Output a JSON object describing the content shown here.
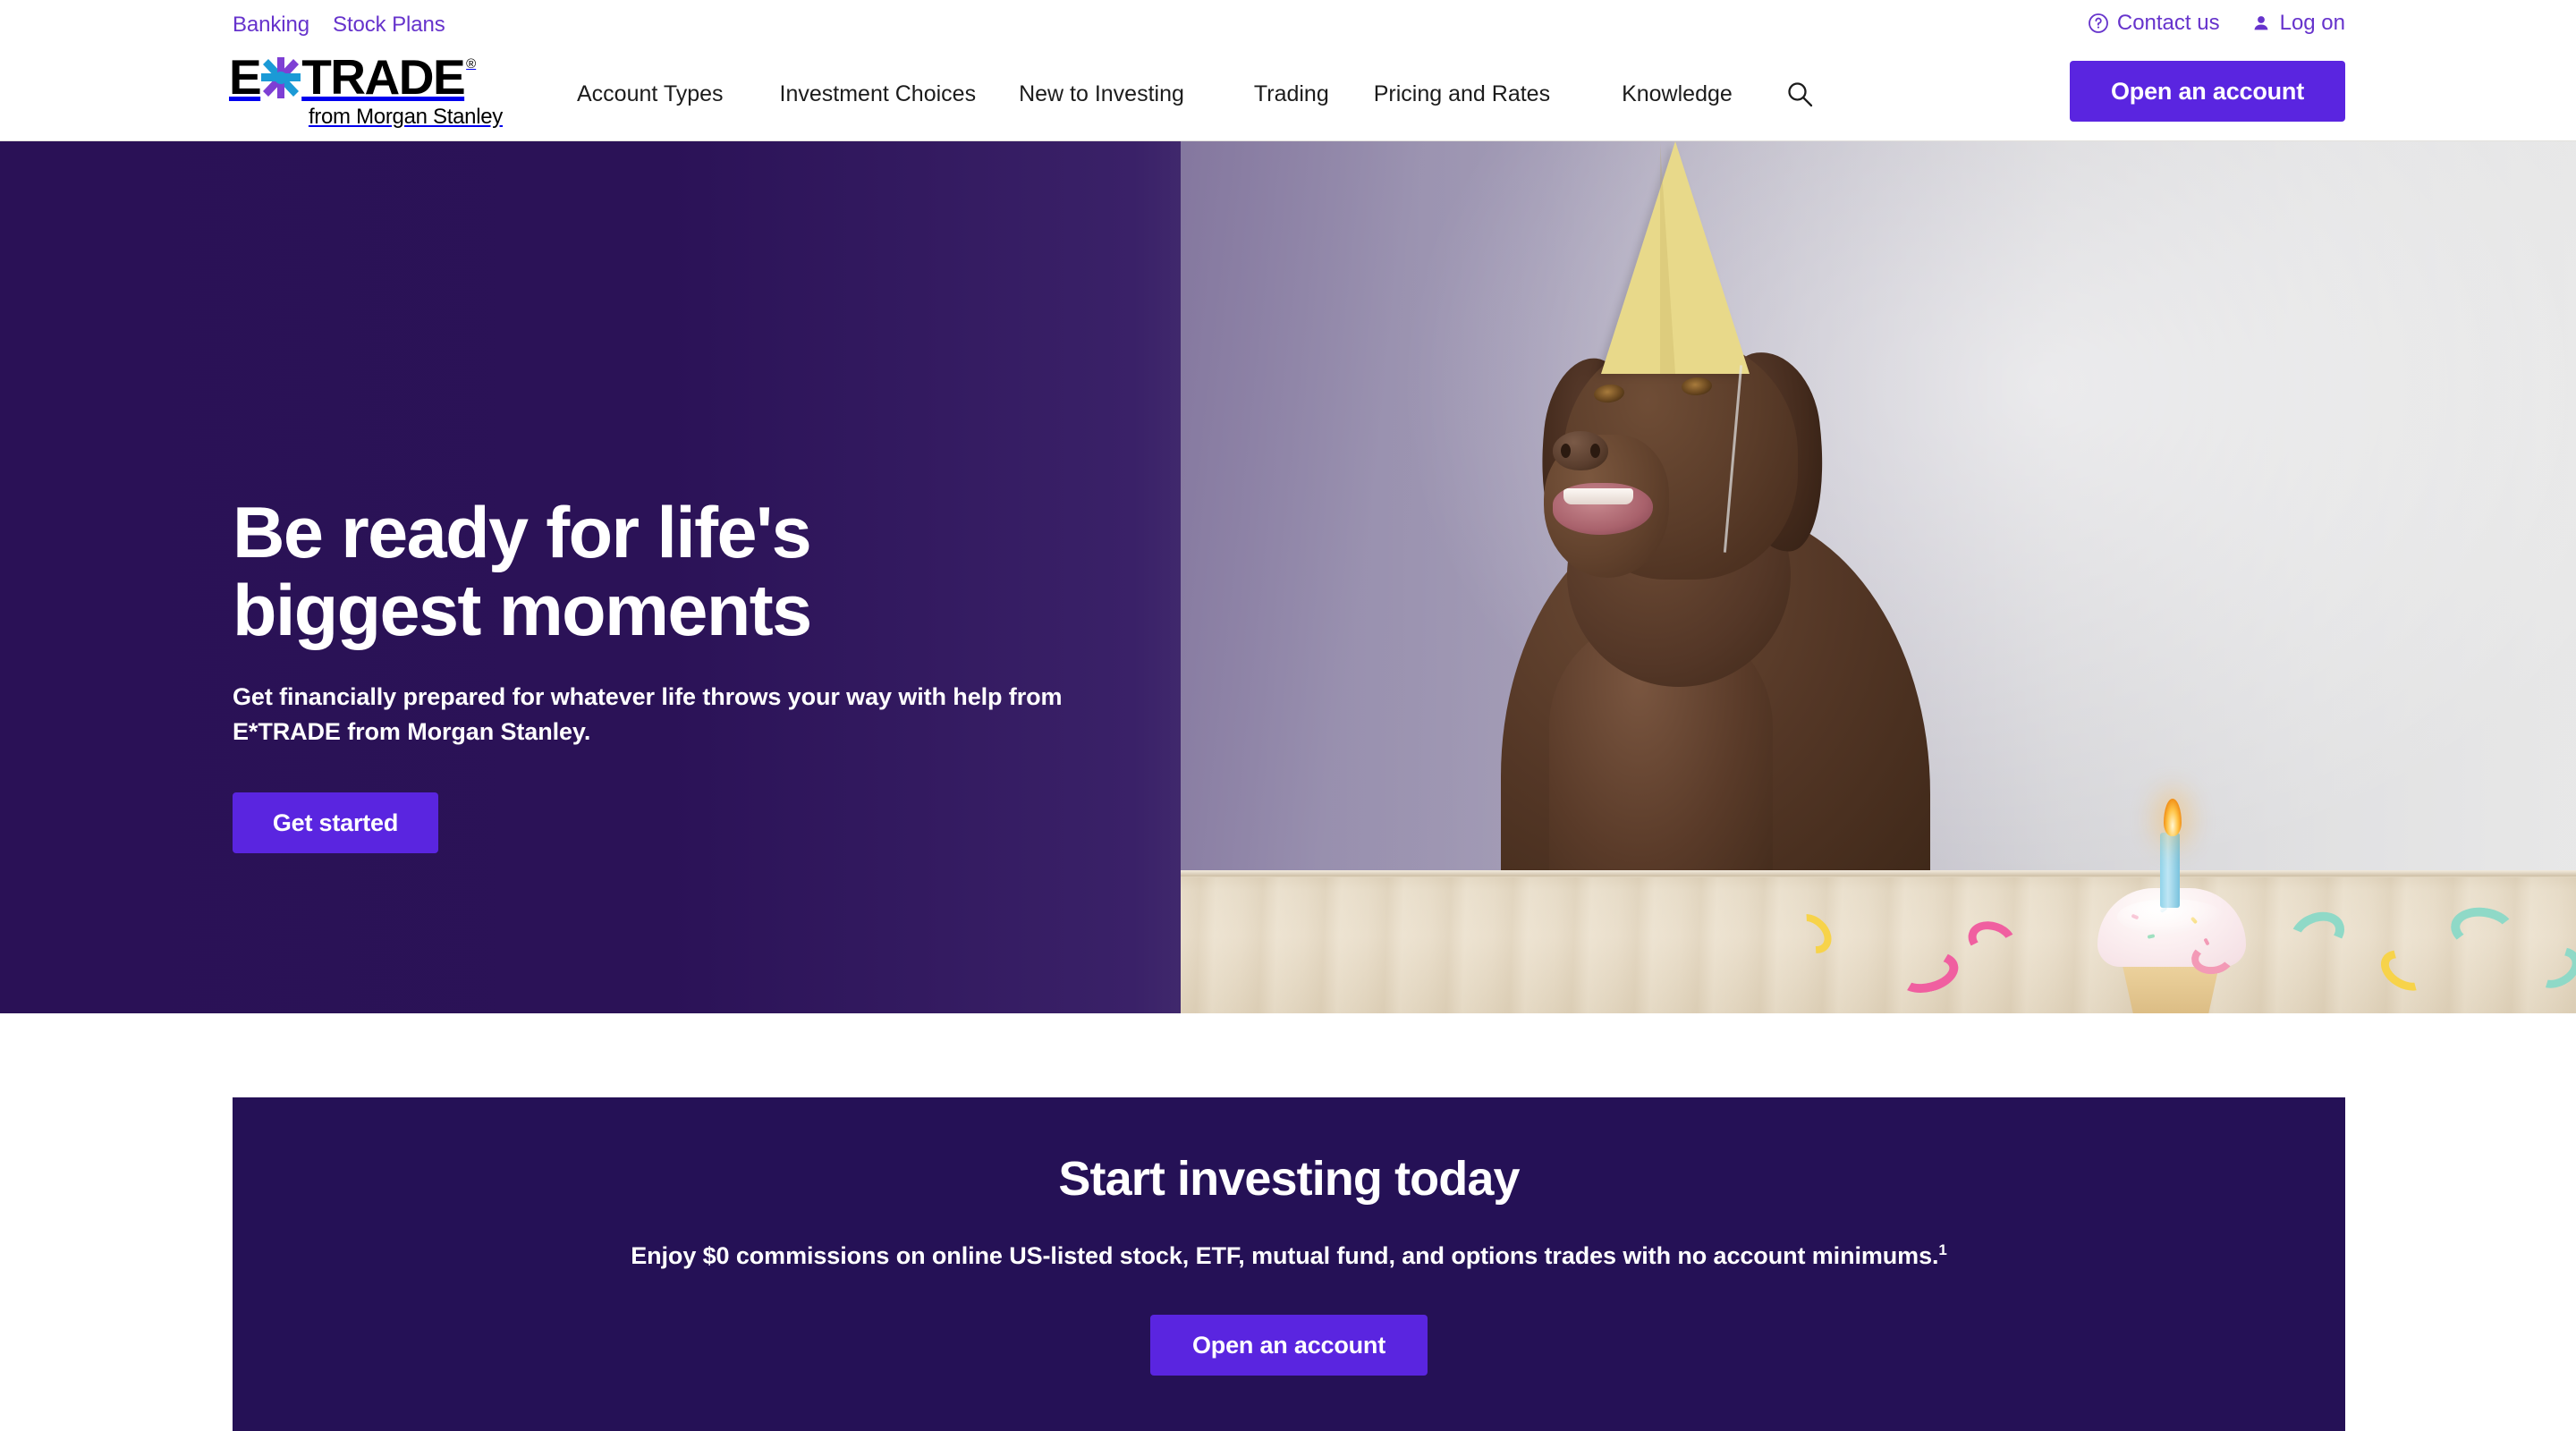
{
  "header": {
    "utility_left": [
      {
        "label": "Banking"
      },
      {
        "label": "Stock Plans"
      }
    ],
    "utility_right": [
      {
        "label": "Contact us",
        "icon": "question-circle-icon"
      },
      {
        "label": "Log on",
        "icon": "person-icon"
      }
    ],
    "logo": {
      "part1": "E",
      "star": "asterisk-star-icon",
      "part2": "TRADE",
      "registered": "®",
      "tagline": "from Morgan Stanley"
    },
    "nav": [
      {
        "label": "Account Types"
      },
      {
        "label": "Investment Choices"
      },
      {
        "label": "New to Investing"
      },
      {
        "label": "Trading"
      },
      {
        "label": "Pricing and Rates"
      },
      {
        "label": "Knowledge"
      }
    ],
    "search_icon": "search-icon",
    "open_account_label": "Open an account"
  },
  "hero": {
    "title_line1": "Be ready for life's",
    "title_line2": "biggest moments",
    "subtitle": "Get financially prepared for whatever life throws your way with help from E*TRADE from Morgan Stanley.",
    "cta_label": "Get started",
    "image_alt": "chocolate-labrador-with-party-hat-and-cupcake"
  },
  "cta_card": {
    "title": "Start investing today",
    "subtitle": "Enjoy $0 commissions on online US-listed stock, ETF, mutual fund, and options trades with no account minimums.",
    "footnote_marker": "1",
    "button_label": "Open an account"
  },
  "colors": {
    "brand_purple": "#5A25E0",
    "link_purple": "#6633CC",
    "deep_purple": "#251156",
    "hero_dark": "#2A1156",
    "logo_star_purple": "#7E3FD4",
    "logo_star_blue": "#1B9AD6"
  }
}
